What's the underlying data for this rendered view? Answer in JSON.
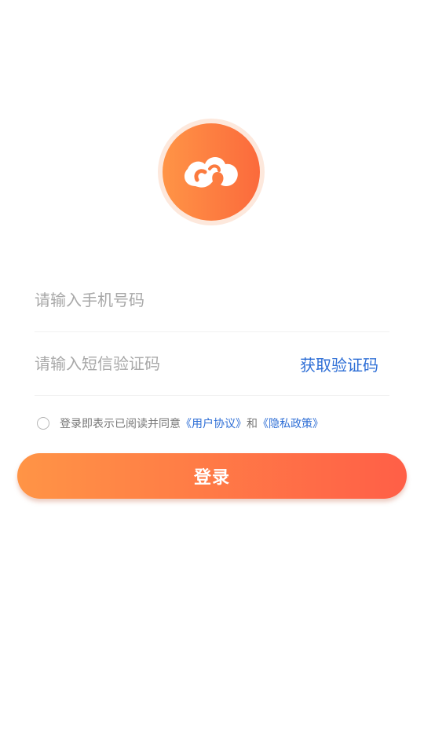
{
  "logo": {
    "icon": "cloud-logo-icon"
  },
  "phone": {
    "placeholder": "请输入手机号码",
    "value": ""
  },
  "code": {
    "placeholder": "请输入短信验证码",
    "value": "",
    "get_code_label": "获取验证码"
  },
  "agreement": {
    "prefix": "登录即表示已阅读并同意",
    "user_agreement": "《用户协议》",
    "and": "和",
    "privacy_policy": "《隐私政策》",
    "checked": false
  },
  "login_label": "登录",
  "colors": {
    "accent_start": "#ff9446",
    "accent_end": "#ff5f47",
    "link": "#2f6fd6"
  }
}
